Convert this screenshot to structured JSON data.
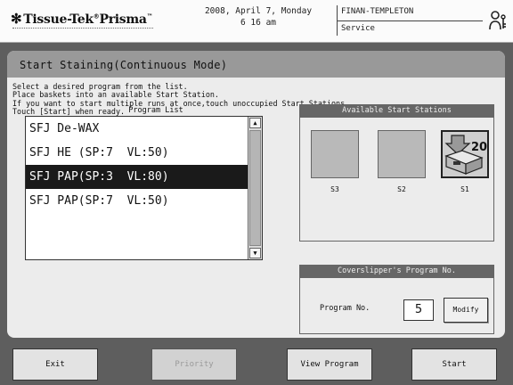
{
  "header": {
    "brand": "Tissue-Tek",
    "brand_model": "Prisma",
    "trademark_1": "®",
    "trademark_2": "™",
    "date_line": "2008, April 7, Monday",
    "time_line": "6 16 am",
    "user_name": "FINAN-TEMPLETON",
    "user_role": "Service",
    "user_icon": "user-key-icon"
  },
  "screen": {
    "title": "Start Staining(Continuous Mode)",
    "instructions": [
      "Select a desired program from the list.",
      "Place baskets into an available Start Station.",
      "If you want to start multiple runs at once,touch unoccupied Start Stations.",
      "Touch [Start] when ready."
    ]
  },
  "program_list": {
    "label": "Program List",
    "items": [
      "SFJ De-WAX",
      "SFJ HE (SP:7  VL:50)",
      "SFJ PAP(SP:3  VL:80)",
      "SFJ PAP(SP:7  VL:50)"
    ],
    "selected_index": 2,
    "scroll_up_icon": "triangle-up-icon",
    "scroll_down_icon": "triangle-down-icon"
  },
  "stations": {
    "header": "Available Start Stations",
    "items": [
      {
        "label": "S3",
        "occupied": false
      },
      {
        "label": "S2",
        "occupied": false
      },
      {
        "label": "S1",
        "occupied": true,
        "basket_count": "20",
        "icon": "basket-arrow-icon"
      }
    ]
  },
  "coverslipper": {
    "header": "Coverslipper's  Program  No.",
    "program_label": "Program No.",
    "program_value": "5",
    "modify_label": "Modify"
  },
  "buttons": {
    "exit": "Exit",
    "priority": "Priority",
    "view_program": "View Program",
    "start": "Start"
  },
  "colors": {
    "background": "#5e5e5e",
    "panel": "#ececec",
    "title_bar": "#999999",
    "selected_row": "#1a1a1a",
    "section_header": "#666666",
    "station_empty": "#b9b9b9",
    "basket_arrow": "#999999"
  }
}
